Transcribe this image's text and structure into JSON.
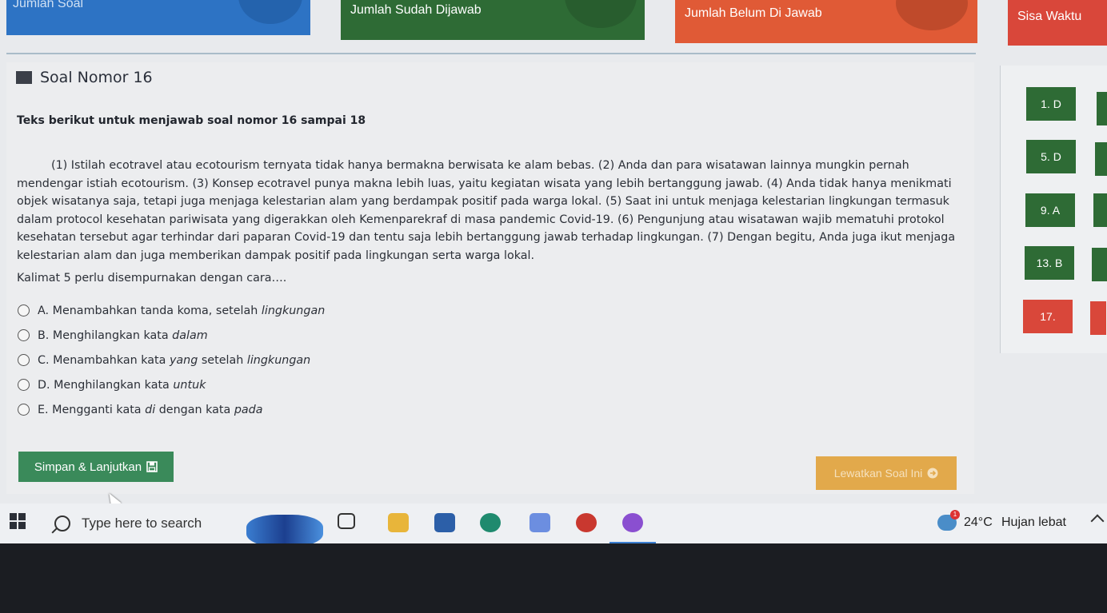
{
  "stats": {
    "total_label": "Jumlah Soal",
    "answered_label": "Jumlah Sudah Dijawab",
    "unanswered_label": "Jumlah Belum Di Jawab",
    "time_label": "Sisa Waktu"
  },
  "question": {
    "header": "Soal Nomor 16",
    "passage_title": "Teks berikut untuk menjawab soal nomor 16 sampai 18",
    "passage": "(1) Istilah ecotravel atau ecotourism ternyata tidak hanya bermakna berwisata ke alam bebas. (2) Anda dan para wisatawan lainnya mungkin pernah mendengar istiah ecotourism. (3) Konsep ecotravel punya makna lebih luas, yaitu kegiatan wisata yang lebih bertanggung jawab. (4) Anda tidak hanya menikmati objek wisatanya saja, tetapi juga menjaga kelestarian alam yang berdampak positif pada warga lokal. (5) Saat ini untuk menjaga kelestarian lingkungan termasuk dalam protocol kesehatan pariwisata yang digerakkan oleh Kemenparekraf di masa pandemic Covid-19. (6) Pengunjung atau wisatawan wajib mematuhi protokol kesehatan tersebut agar terhindar dari paparan Covid-19 dan tentu saja lebih bertanggung jawab terhadap lingkungan. (7) Dengan begitu, Anda juga ikut menjaga kelestarian alam dan juga memberikan dampak positif pada lingkungan serta warga lokal.",
    "prompt": "Kalimat 5 perlu disempurnakan dengan cara….",
    "options": [
      {
        "text": "A. Menambahkan tanda koma, setelah ",
        "em": "lingkungan",
        "tail": ""
      },
      {
        "text": "B. Menghilangkan kata ",
        "em": "dalam",
        "tail": ""
      },
      {
        "text": "C. Menambahkan kata ",
        "em": "yang",
        "tail": " setelah ",
        "em2": "lingkungan"
      },
      {
        "text": "D. Menghilangkan kata ",
        "em": "untuk",
        "tail": ""
      },
      {
        "text": "E. Mengganti kata ",
        "em": "di",
        "tail": " dengan kata ",
        "em2": "pada"
      }
    ],
    "save_label": "Simpan & Lanjutkan",
    "skip_label": "Lewatkan Soal Ini"
  },
  "answers": [
    {
      "label": "1. D",
      "status": "answered"
    },
    {
      "label": "5. D",
      "status": "answered"
    },
    {
      "label": "9. A",
      "status": "answered"
    },
    {
      "label": "13. B",
      "status": "answered"
    },
    {
      "label": "17.",
      "status": "unanswered"
    }
  ],
  "taskbar": {
    "search_placeholder": "Type here to search",
    "temperature": "24°C",
    "weather": "Hujan lebat"
  },
  "colors": {
    "answered": "#2e6b35",
    "unanswered": "#d9473a",
    "total": "#2d73c4",
    "save_button": "#3a8a5a",
    "skip_button": "#e2a23a"
  }
}
